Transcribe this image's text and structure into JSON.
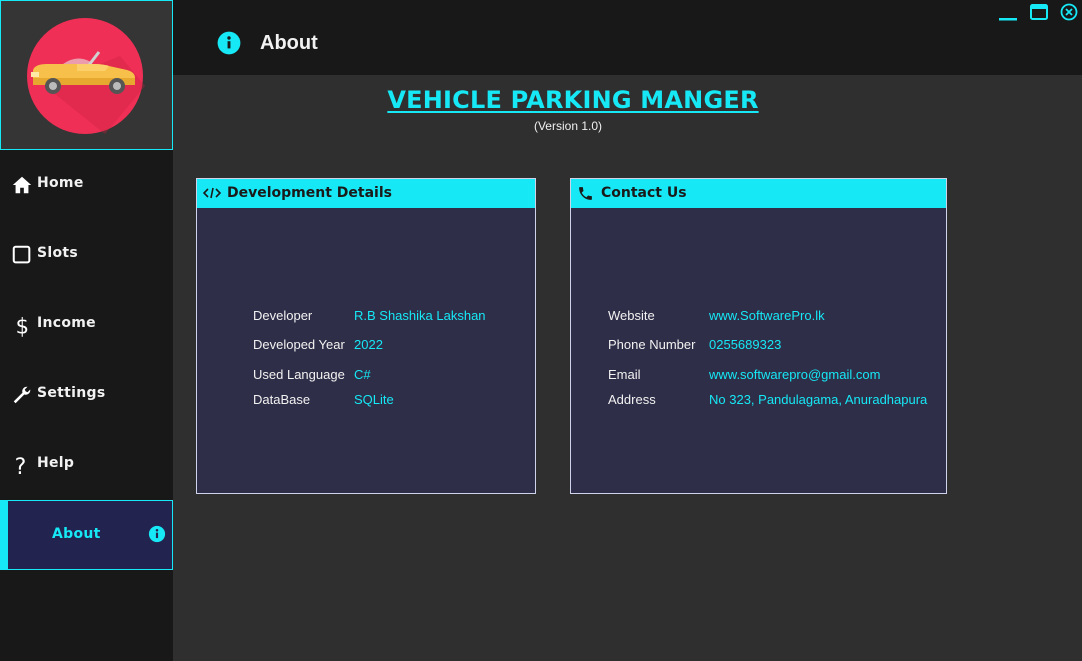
{
  "colors": {
    "accent": "#16e8f5",
    "sidebar_bg": "#181818",
    "content_bg": "#2f2f2f",
    "panel_bg": "#2e2e48",
    "active_bg": "#232350"
  },
  "sidebar": {
    "logo_icon": "car-logo-icon",
    "items": [
      {
        "label": "Home",
        "icon": "home-icon"
      },
      {
        "label": "Slots",
        "icon": "square-icon"
      },
      {
        "label": "Income",
        "icon": "dollar-icon"
      },
      {
        "label": "Settings",
        "icon": "wrench-icon"
      },
      {
        "label": "Help",
        "icon": "question-icon"
      },
      {
        "label": "About",
        "icon": "info-icon",
        "active": true
      }
    ]
  },
  "header": {
    "title": "About",
    "icon": "info-icon"
  },
  "window_controls": [
    "minimize-icon",
    "maximize-icon",
    "close-icon"
  ],
  "app": {
    "title": "VEHICLE PARKING MANGER",
    "version": "(Version 1.0)"
  },
  "dev_panel": {
    "title": "Development Details",
    "icon": "code-icon",
    "rows": [
      {
        "label": "Developer",
        "value": "R.B Shashika Lakshan"
      },
      {
        "label": "Developed Year",
        "value": "2022"
      },
      {
        "label": "Used Language",
        "value": "C#"
      },
      {
        "label": "DataBase",
        "value": "SQLite"
      }
    ]
  },
  "contact_panel": {
    "title": "Contact Us",
    "icon": "phone-icon",
    "rows": [
      {
        "label": "Website",
        "value": "www.SoftwarePro.lk"
      },
      {
        "label": "Phone Number",
        "value": "0255689323"
      },
      {
        "label": "Email",
        "value": "www.softwarepro@gmail.com"
      },
      {
        "label": "Address",
        "value": "No 323, Pandulagama, Anuradhapura"
      }
    ]
  }
}
